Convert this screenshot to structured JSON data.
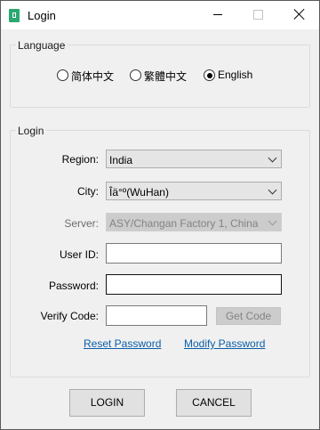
{
  "window": {
    "title": "Login"
  },
  "language": {
    "group_title": "Language",
    "options": [
      {
        "label": "简体中文",
        "selected": false
      },
      {
        "label": "繁體中文",
        "selected": false
      },
      {
        "label": "English",
        "selected": true
      }
    ]
  },
  "login": {
    "group_title": "Login",
    "region": {
      "label": "Region:",
      "value": "India"
    },
    "city": {
      "label": "City:",
      "value": "Îä°º(WuHan)"
    },
    "server": {
      "label": "Server:",
      "value": "ASY/Changan Factory 1, China",
      "disabled": true
    },
    "user_id": {
      "label": "User ID:",
      "value": ""
    },
    "password": {
      "label": "Password:",
      "value": ""
    },
    "verify_code": {
      "label": "Verify Code:",
      "value": "",
      "get_code_label": "Get Code"
    },
    "reset_password_label": "Reset Password",
    "modify_password_label": "Modify Password"
  },
  "buttons": {
    "login_label": "LOGIN",
    "cancel_label": "CANCEL"
  },
  "colors": {
    "link": "#0b5ea8",
    "app_icon": "#2aa871"
  }
}
